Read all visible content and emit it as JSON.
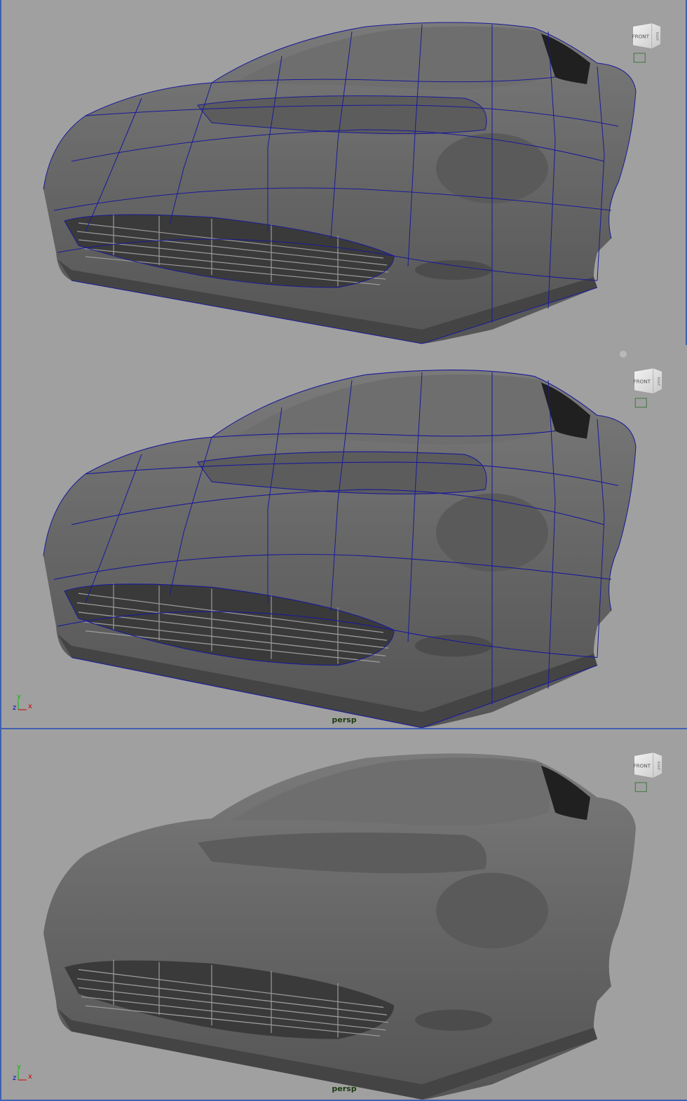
{
  "viewports": [
    {
      "id": "low-poly",
      "camera_label": "",
      "viewcube_label": "FRONT",
      "viewcube_side_label": "RIGHT",
      "wireframe": true,
      "smooth": false
    },
    {
      "id": "smoothed-wire",
      "camera_label": "persp",
      "viewcube_label": "FRONT",
      "viewcube_side_label": "RIGHT",
      "wireframe": true,
      "smooth": true
    },
    {
      "id": "smoothed-shaded",
      "camera_label": "persp",
      "viewcube_label": "FRONT",
      "viewcube_side_label": "RIGHT",
      "wireframe": false,
      "smooth": true
    }
  ],
  "axis": {
    "y": "y",
    "z": "z",
    "x": "x"
  },
  "colors": {
    "background": "#a0a0a0",
    "wire": "#1a1a9a",
    "body": "#6a6a6a",
    "body_dark": "#4a4a4a",
    "body_light": "#7c7c7c",
    "border": "#4060b0",
    "axis_y": "#00c000",
    "axis_x": "#d00000",
    "axis_z": "#0000d0"
  }
}
